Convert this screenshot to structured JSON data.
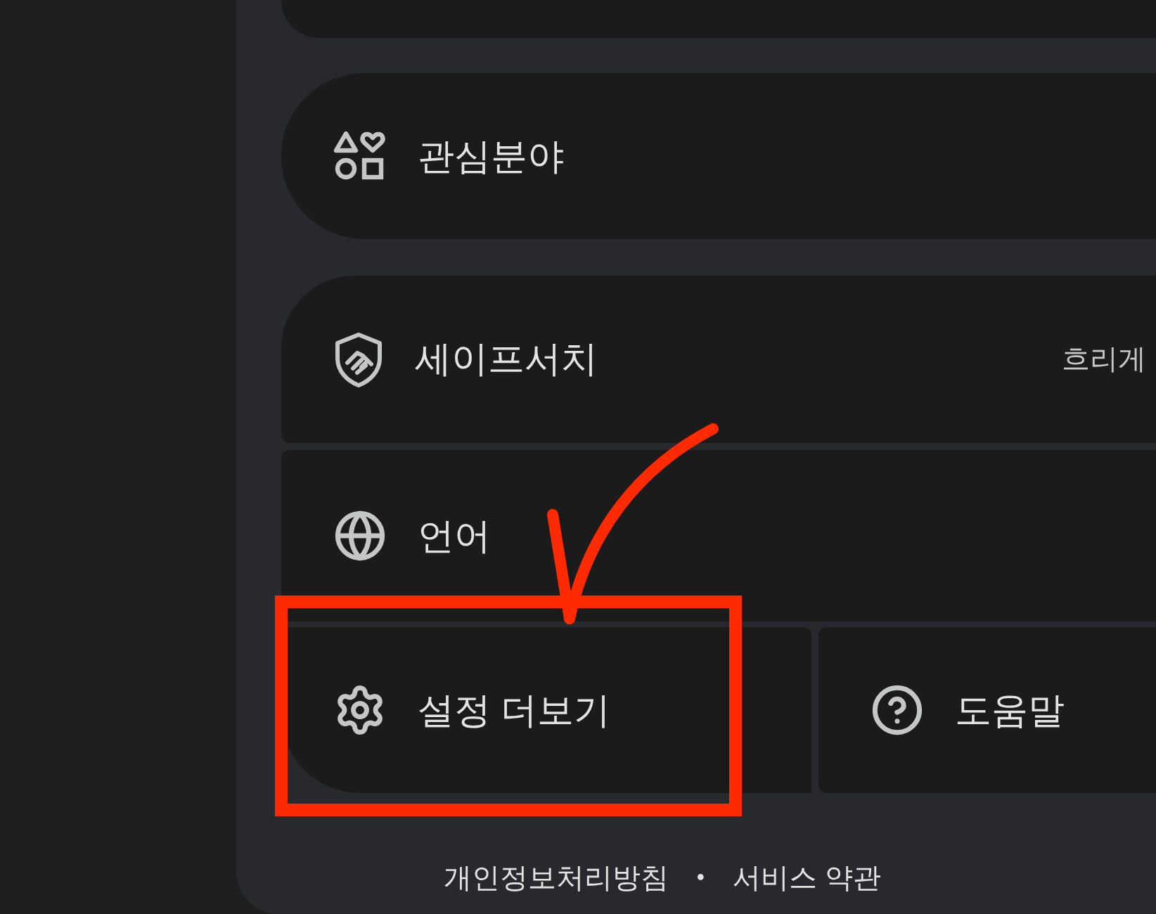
{
  "items": [
    {
      "kind": "interests",
      "label": "관심분야"
    },
    {
      "kind": "safesearch",
      "label": "세이프서치",
      "value": "흐리게"
    },
    {
      "kind": "language",
      "label": "언어"
    }
  ],
  "bottom_buttons": [
    {
      "kind": "settings",
      "label": "설정 더보기"
    },
    {
      "kind": "help",
      "label": "도움말"
    }
  ],
  "footer_links": [
    "개인정보처리방침",
    "서비스 약관"
  ],
  "footer_separator": "•"
}
